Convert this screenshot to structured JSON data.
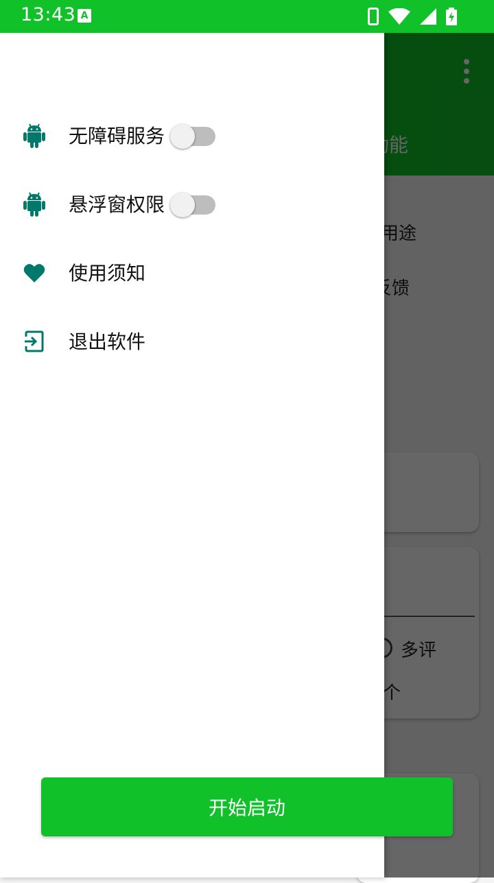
{
  "status_bar": {
    "time": "13:43",
    "notification_label": "A"
  },
  "app": {
    "title_partial": "功能",
    "line1": "用途",
    "line2": "反馈",
    "card2_option": "多评",
    "card2_text": "个"
  },
  "drawer": {
    "items": [
      {
        "label": "无障碍服务",
        "icon": "android-icon",
        "toggle": false
      },
      {
        "label": "悬浮窗权限",
        "icon": "android-icon",
        "toggle": false
      },
      {
        "label": "使用须知",
        "icon": "heart-icon"
      },
      {
        "label": "退出软件",
        "icon": "exit-icon"
      }
    ]
  },
  "start_button": {
    "label": "开始启动"
  },
  "colors": {
    "accent": "#11c12a",
    "icon": "#00796b",
    "scrim": "rgba(0,0,0,0.6)"
  }
}
